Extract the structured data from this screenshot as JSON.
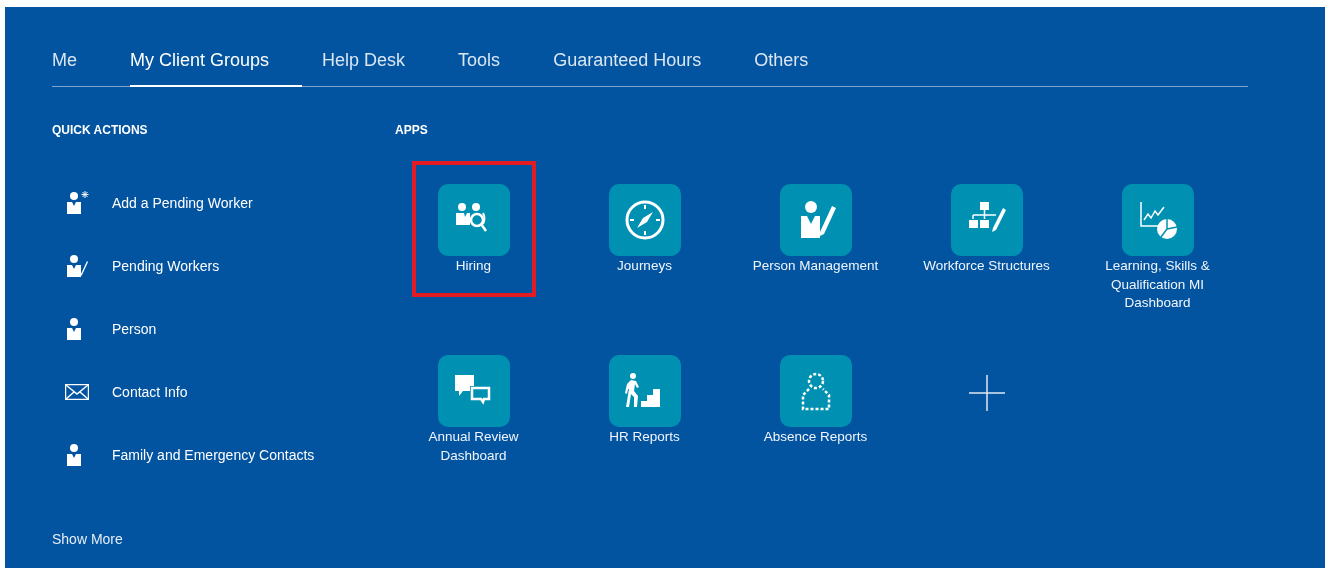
{
  "tabs": [
    {
      "label": "Me",
      "selected": false
    },
    {
      "label": "My Client Groups",
      "selected": true
    },
    {
      "label": "Help Desk",
      "selected": false
    },
    {
      "label": "Tools",
      "selected": false
    },
    {
      "label": "Guaranteed Hours",
      "selected": false
    },
    {
      "label": "Others",
      "selected": false
    }
  ],
  "quick_actions": {
    "heading": "QUICK ACTIONS",
    "items": [
      {
        "label": "Add a Pending Worker"
      },
      {
        "label": "Pending Workers"
      },
      {
        "label": "Person"
      },
      {
        "label": "Contact Info"
      },
      {
        "label": "Family and Emergency Contacts"
      }
    ],
    "show_more": "Show More"
  },
  "apps": {
    "heading": "APPS",
    "items": [
      {
        "label": "Hiring",
        "highlighted": true
      },
      {
        "label": "Journeys",
        "highlighted": false
      },
      {
        "label": "Person Management",
        "highlighted": false
      },
      {
        "label": "Workforce Structures",
        "highlighted": false
      },
      {
        "label": "Learning, Skills & Qualification MI Dashboard",
        "highlighted": false
      },
      {
        "label": "Annual Review Dashboard",
        "highlighted": false
      },
      {
        "label": "HR Reports",
        "highlighted": false
      },
      {
        "label": "Absence Reports",
        "highlighted": false
      }
    ]
  }
}
